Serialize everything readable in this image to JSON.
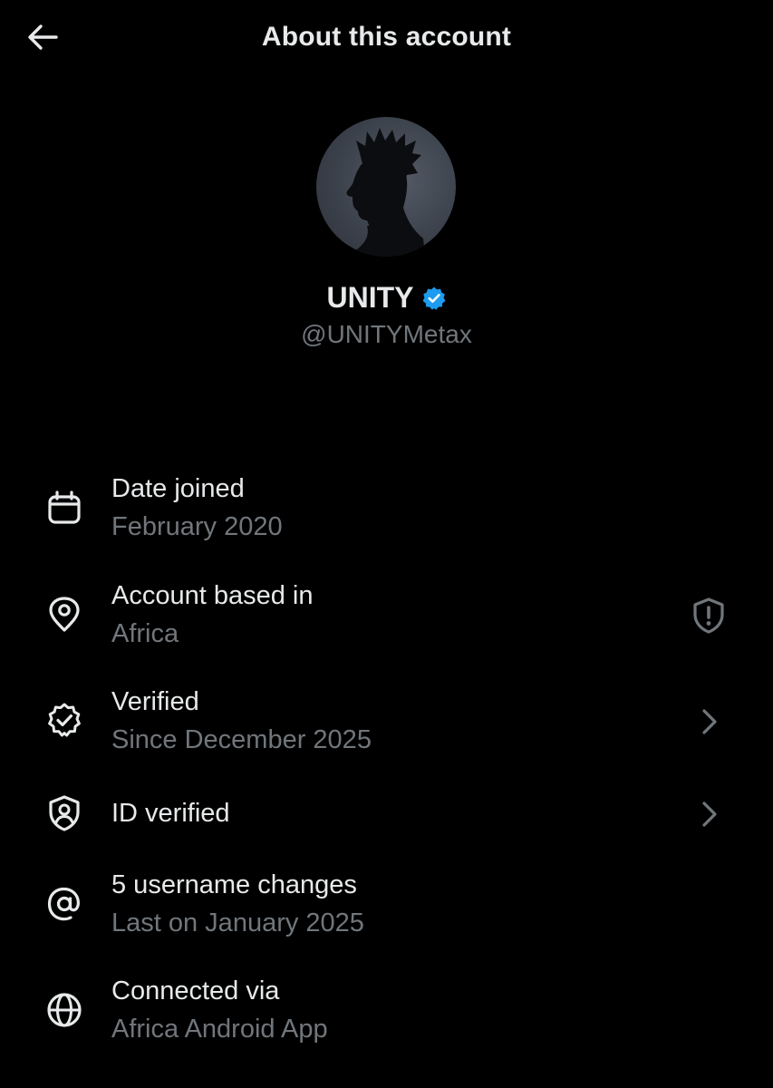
{
  "header": {
    "title": "About this account",
    "back_icon": "arrow-left-icon"
  },
  "profile": {
    "display_name": "UNITY",
    "handle": "@UNITYMetax",
    "verified_badge_color": "#1d9bf0",
    "avatar": "silhouette-profile-photo"
  },
  "rows": [
    {
      "icon": "calendar-icon",
      "title": "Date joined",
      "subtitle": "February 2020",
      "trailing": null
    },
    {
      "icon": "location-pin-icon",
      "title": "Account based in",
      "subtitle": "Africa",
      "trailing": "shield-alert-icon"
    },
    {
      "icon": "verified-seal-icon",
      "title": "Verified",
      "subtitle": "Since December 2025",
      "trailing": "chevron-right-icon"
    },
    {
      "icon": "id-shield-icon",
      "title": "ID verified",
      "subtitle": "",
      "trailing": "chevron-right-icon"
    },
    {
      "icon": "at-sign-icon",
      "title": "5 username changes",
      "subtitle": "Last on January 2025",
      "trailing": null
    },
    {
      "icon": "globe-icon",
      "title": "Connected via",
      "subtitle": "Africa Android App",
      "trailing": null
    }
  ],
  "colors": {
    "background": "#000000",
    "primary_text": "#e7e9ea",
    "secondary_text": "#71767b",
    "accent": "#1d9bf0"
  }
}
